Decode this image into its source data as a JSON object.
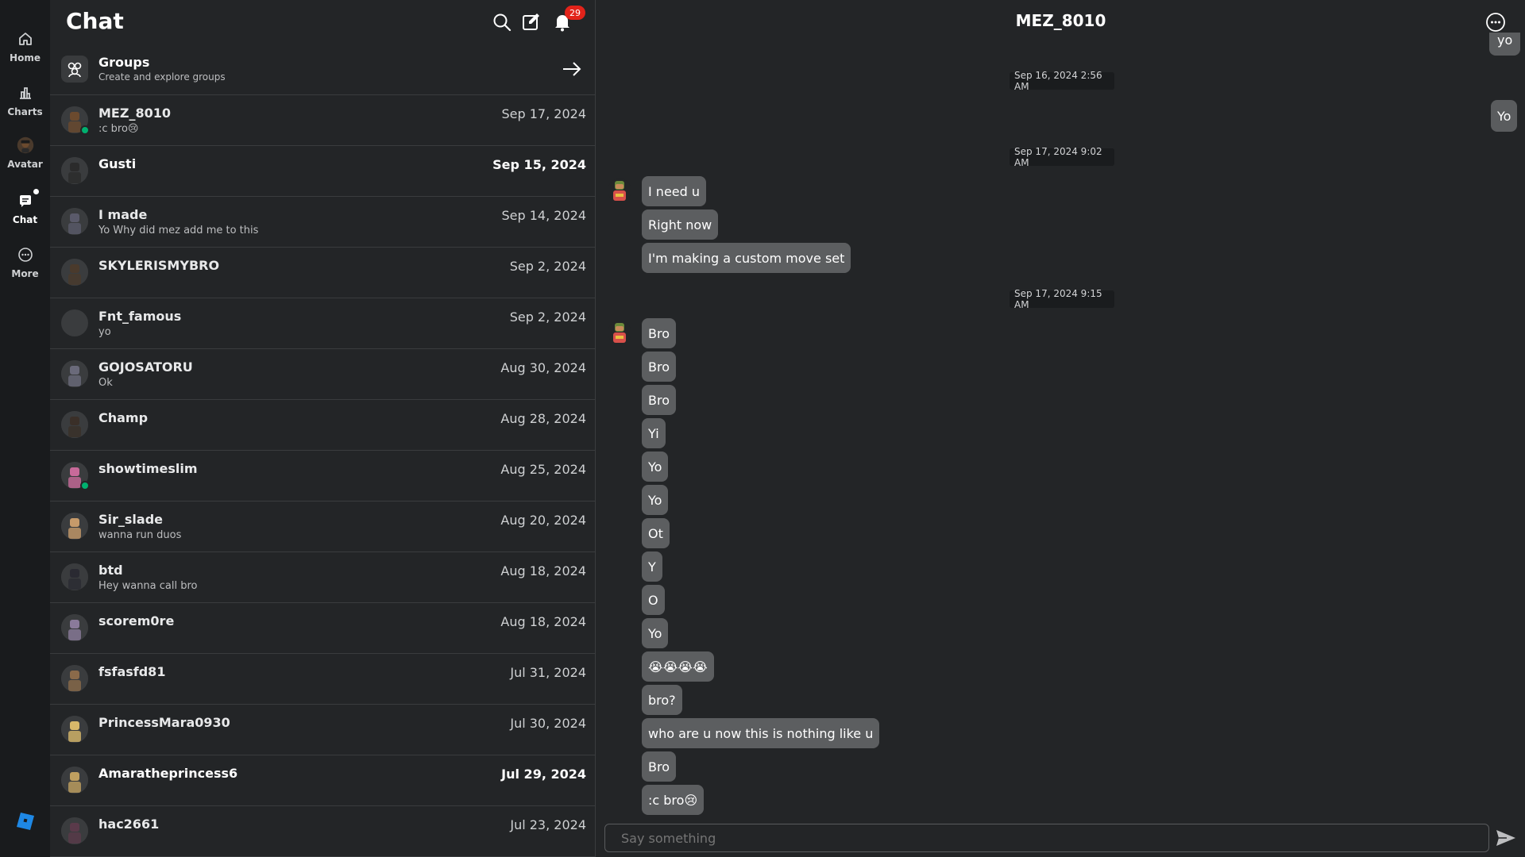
{
  "nav": {
    "items": [
      {
        "label": "Home",
        "icon": "home-icon"
      },
      {
        "label": "Charts",
        "icon": "charts-icon"
      },
      {
        "label": "Avatar",
        "icon": "avatar-icon"
      },
      {
        "label": "Chat",
        "icon": "chat-icon"
      },
      {
        "label": "More",
        "icon": "more-icon"
      }
    ]
  },
  "list": {
    "title": "Chat",
    "notification_count": "29",
    "groups": {
      "title": "Groups",
      "subtitle": "Create and explore groups"
    },
    "conversations": [
      {
        "name": "MEZ_8010",
        "preview": ":c bro😢",
        "date": "Sep 17, 2024",
        "online": true,
        "unread": false
      },
      {
        "name": "Gusti",
        "preview": "",
        "date": "Sep 15, 2024",
        "online": false,
        "unread": true
      },
      {
        "name": "I made",
        "preview": "Yo Why did mez add me to this",
        "date": "Sep 14, 2024",
        "online": false,
        "unread": false
      },
      {
        "name": "SKYLERISMYBRO",
        "preview": "",
        "date": "Sep 2, 2024",
        "online": false,
        "unread": false
      },
      {
        "name": "Fnt_famous",
        "preview": "yo",
        "date": "Sep 2, 2024",
        "online": false,
        "unread": false
      },
      {
        "name": "GOJOSATORU",
        "preview": "Ok",
        "date": "Aug 30, 2024",
        "online": false,
        "unread": false
      },
      {
        "name": "Champ",
        "preview": "",
        "date": "Aug 28, 2024",
        "online": false,
        "unread": false
      },
      {
        "name": "showtimeslim",
        "preview": "",
        "date": "Aug 25, 2024",
        "online": true,
        "unread": false
      },
      {
        "name": "Sir_slade",
        "preview": "wanna run duos",
        "date": "Aug 20, 2024",
        "online": false,
        "unread": false
      },
      {
        "name": "btd",
        "preview": "Hey wanna call bro",
        "date": "Aug 18, 2024",
        "online": false,
        "unread": false
      },
      {
        "name": "scorem0re",
        "preview": "",
        "date": "Aug 18, 2024",
        "online": false,
        "unread": false
      },
      {
        "name": "fsfasfd81",
        "preview": "",
        "date": "Jul 31, 2024",
        "online": false,
        "unread": false
      },
      {
        "name": "PrincessMara0930",
        "preview": "",
        "date": "Jul 30, 2024",
        "online": false,
        "unread": false
      },
      {
        "name": "Amaratheprincess6",
        "preview": "",
        "date": "Jul 29, 2024",
        "online": false,
        "unread": true
      },
      {
        "name": "hac2661",
        "preview": "",
        "date": "Jul 23, 2024",
        "online": false,
        "unread": false
      }
    ]
  },
  "conversation": {
    "title": "MEZ_8010",
    "top_partial": "yo",
    "stamps": [
      "Sep 16, 2024 2:56 AM",
      "Sep 17, 2024 9:02 AM",
      "Sep 17, 2024 9:15 AM"
    ],
    "my_message": "Yo",
    "group1": [
      "I need u",
      "Right now",
      "I'm making a custom move set"
    ],
    "group2": [
      "Bro",
      "Bro",
      "Bro",
      "Yi",
      "Yo",
      "Yo",
      "Ot",
      "Y",
      "O",
      "Yo",
      "😭😭😭😭",
      "bro?",
      "who are u now this is nothing like u",
      "Bro",
      ":c bro😢"
    ],
    "composer_placeholder": "Say something"
  },
  "colors": {
    "accent_badge": "#e2231a",
    "online": "#00b06f",
    "bubble": "#5c5e60",
    "background": "#232527"
  }
}
